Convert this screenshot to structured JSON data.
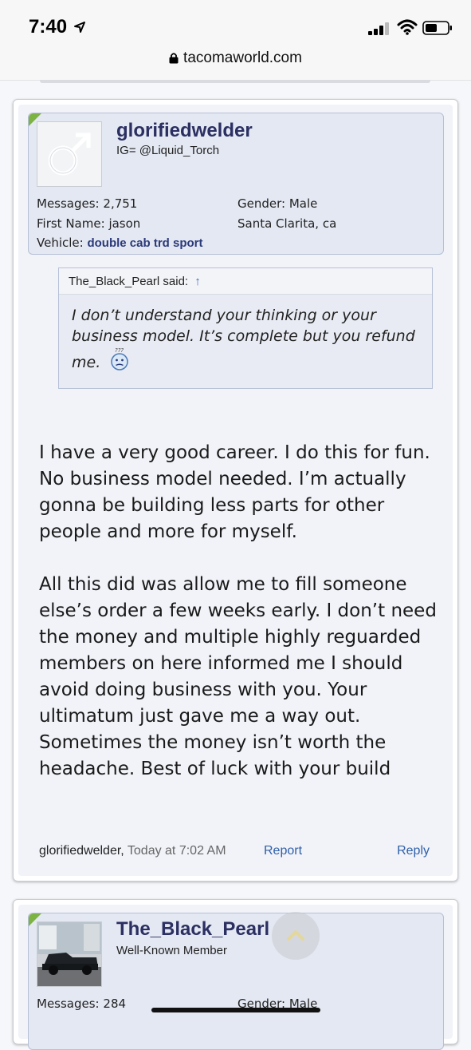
{
  "status": {
    "time": "7:40"
  },
  "browser": {
    "url": "tacomaworld.com"
  },
  "post1": {
    "username": "glorifiedwelder",
    "user_title": "IG= @Liquid_Torch",
    "messages_label": "Messages:",
    "messages_value": "2,751",
    "gender_label": "Gender:",
    "gender_value": "Male",
    "firstname_label": "First Name:",
    "firstname_value": "jason",
    "location": "Santa Clarita, ca",
    "vehicle_label": "Vehicle:",
    "vehicle_value": "double cab trd sport",
    "quote": {
      "author": "The_Black_Pearl said:",
      "up_arrow": "↑",
      "text": "I don’t understand your thinking or your business model. It’s complete but you refund me."
    },
    "message_paragraphs": [
      "I have a very good career. I do this for fun. No business model needed. I’m actually gonna be building less parts for other people and more for myself.",
      "All this did was allow me to fill someone else’s order a few weeks early. I don’t need the money and multiple highly reguarded members on here informed me I should avoid doing business with you. Your ultimatum just gave me a way out. Sometimes the money isn’t worth the headache. Best of luck with your build"
    ],
    "footer_author": "glorifiedwelder",
    "footer_sep": ",",
    "footer_date": "Today at 7:02 AM",
    "report_label": "Report",
    "reply_label": "Reply"
  },
  "post2": {
    "username": "The_Black_Pearl",
    "user_title": "Well-Known Member",
    "messages_label": "Messages:",
    "messages_value": "284",
    "gender_label": "Gender:",
    "gender_value": "Male"
  },
  "colors": {
    "username": "#2b2f62",
    "link": "#2f5fa8",
    "badge_corner": "#7cb342"
  },
  "icons": [
    "location-arrow-icon",
    "signal-icon",
    "wifi-icon",
    "battery-icon",
    "lock-icon",
    "male-avatar-icon",
    "confused-smiley-icon",
    "scroll-top-icon"
  ]
}
